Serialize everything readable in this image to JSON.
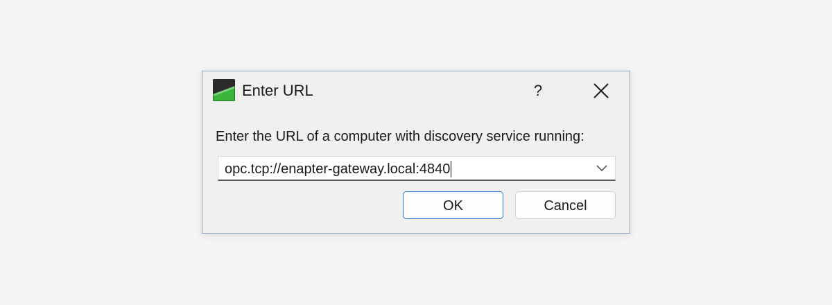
{
  "dialog": {
    "title": "Enter URL",
    "help_label": "?",
    "prompt": "Enter the URL of a computer with discovery service running:",
    "url_value": "opc.tcp://enapter-gateway.local:4840",
    "ok_label": "OK",
    "cancel_label": "Cancel"
  },
  "icons": {
    "app": "app-logo-icon",
    "close": "close-icon",
    "dropdown": "chevron-down-icon"
  },
  "colors": {
    "dialog_bg": "#f0f0f0",
    "default_button_border": "#2f74c9",
    "icon_green": "#3cb53c"
  }
}
